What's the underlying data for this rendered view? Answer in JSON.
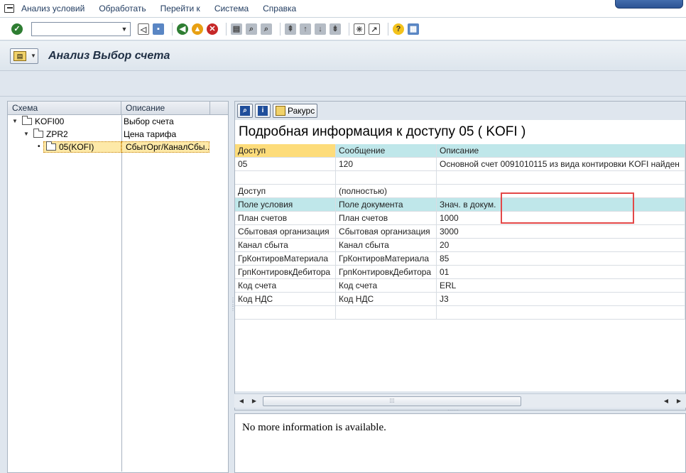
{
  "menubar": {
    "items": [
      "Анализ условий",
      "Обработать",
      "Перейти к",
      "Система",
      "Справка"
    ]
  },
  "toolbar": {
    "command_value": ""
  },
  "title": {
    "text": "Анализ Выбор счета"
  },
  "tree": {
    "headers": [
      "Схема",
      "Описание"
    ],
    "rows": [
      {
        "label": "KOFI00",
        "desc": "Выбор счета"
      },
      {
        "label": "ZPR2",
        "desc": "Цена тарифа"
      },
      {
        "label": "05(KOFI)",
        "desc": "СбытОрг/КаналСбы..."
      }
    ]
  },
  "detail": {
    "toolbar_raccourse": "Ракурс",
    "heading": "Подробная информация к доступу 05 ( KOFI )",
    "columns": [
      "Доступ",
      "Сообщение",
      "Описание"
    ],
    "access_row": [
      "05",
      "120",
      "Основной счет 0091010115 из вида контировки KOFI найден"
    ],
    "access_full_row": [
      "Доступ",
      "(полностью)",
      ""
    ],
    "fields_header": [
      "Поле условия",
      "Поле документа",
      "Знач. в докум."
    ],
    "fields": [
      [
        "План счетов",
        "План счетов",
        "1000"
      ],
      [
        "Сбытовая организация",
        "Сбытовая организация",
        "3000"
      ],
      [
        "Канал сбыта",
        "Канал сбыта",
        "20"
      ],
      [
        "ГрКонтировМатериала",
        "ГрКонтировМатериала",
        "85"
      ],
      [
        "ГрпКонтировкДебитора",
        "ГрпКонтировкДебитора",
        "01"
      ],
      [
        "Код счета",
        "Код счета",
        "ERL"
      ],
      [
        "Код НДС",
        "Код НДС",
        "J3"
      ]
    ]
  },
  "info": {
    "message": "No more information is available."
  },
  "colors": {
    "selected_header": "#fddc7a",
    "teal_header": "#bfe7ea",
    "highlight_box": "#e34848"
  }
}
